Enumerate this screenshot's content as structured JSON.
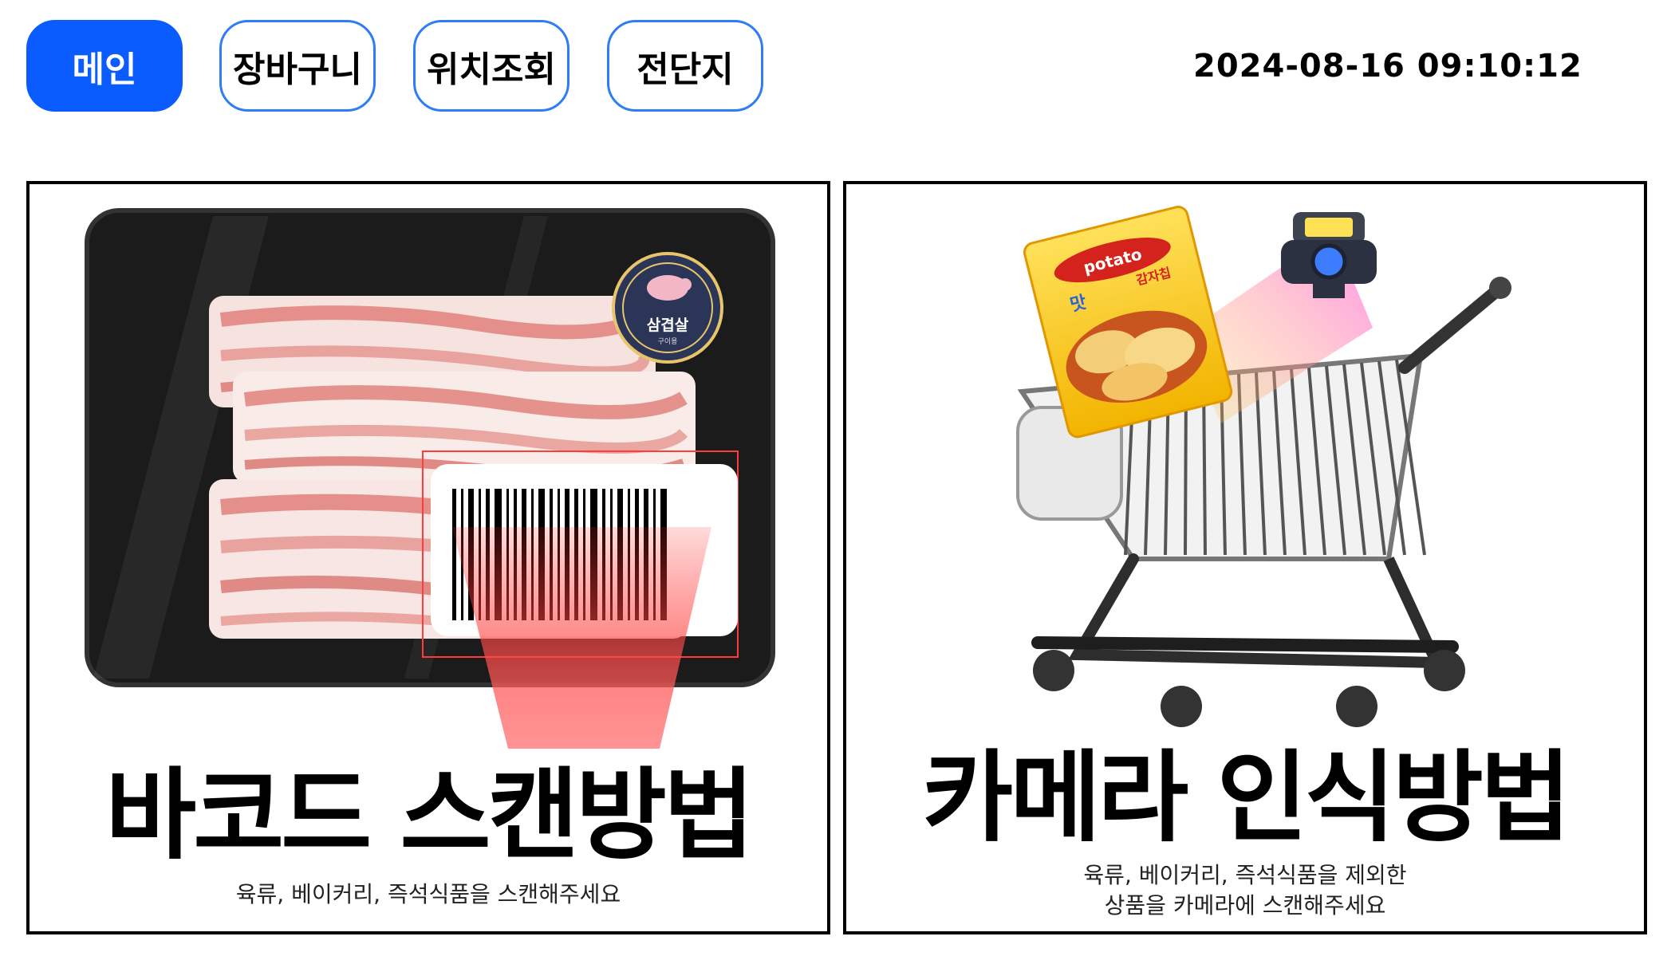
{
  "nav": {
    "tabs": [
      {
        "label": "메인",
        "active": true
      },
      {
        "label": "장바구니",
        "active": false
      },
      {
        "label": "위치조회",
        "active": false
      },
      {
        "label": "전단지",
        "active": false
      }
    ]
  },
  "clock": {
    "datetime": "2024-08-16 09:10:12"
  },
  "panels": {
    "barcode": {
      "title": "바코드 스캔방법",
      "description": "육류, 베이커리, 즉석식품을 스캔해주세요",
      "badge_label": "삼겹살",
      "badge_sub": "구이용"
    },
    "camera": {
      "title": "카메라 인식방법",
      "description_line1": "육류, 베이커리, 즉석식품을 제외한",
      "description_line2": "상품을 카메라에 스캔해주세요",
      "bag_brand": "potato",
      "bag_sub": "감자칩",
      "bag_tag": "맛"
    }
  },
  "colors": {
    "accent": "#0a5cff",
    "border": "#2f7df6",
    "scan_red": "#ff4d4d"
  }
}
